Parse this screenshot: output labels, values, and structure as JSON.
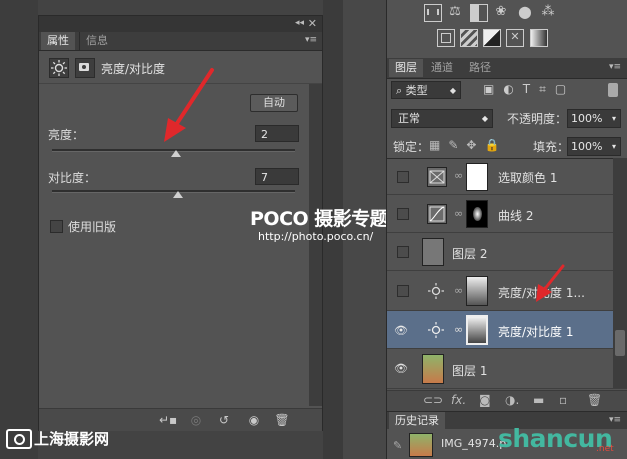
{
  "properties_panel": {
    "tabs": [
      {
        "label": "属性"
      },
      {
        "label": "信息"
      }
    ],
    "header_title": "亮度/对比度",
    "auto_button": "自动",
    "brightness": {
      "label": "亮度：",
      "value": "2",
      "level": 0.51
    },
    "contrast": {
      "label": "对比度：",
      "value": "7",
      "level": 0.52
    },
    "legacy_checkbox": {
      "label": "使用旧版",
      "checked": false
    }
  },
  "layers_panel": {
    "tabs": [
      {
        "label": "图层"
      },
      {
        "label": "通道"
      },
      {
        "label": "路径"
      }
    ],
    "filter_kind": "类型",
    "blend_mode": "正常",
    "opacity_label": "不透明度：",
    "opacity_value": "100%",
    "lock_label": "锁定：",
    "fill_label": "填充：",
    "fill_value": "100%",
    "layers": [
      {
        "name": "选取颜色 1",
        "type": "adjustment",
        "icon": "selective-color-icon",
        "visible": false,
        "selected": false
      },
      {
        "name": "曲线 2",
        "type": "adjustment",
        "icon": "curves-icon",
        "visible": false,
        "selected": false
      },
      {
        "name": "图层 2",
        "type": "pixel",
        "icon": "",
        "visible": false,
        "selected": false
      },
      {
        "name": "亮度/对比度 1...",
        "type": "adjustment",
        "icon": "brightness-icon",
        "visible": false,
        "selected": false
      },
      {
        "name": "亮度/对比度 1",
        "type": "adjustment",
        "icon": "brightness-icon",
        "visible": true,
        "selected": true
      },
      {
        "name": "图层 1",
        "type": "pixel",
        "icon": "",
        "visible": true,
        "selected": false
      }
    ]
  },
  "history_panel": {
    "title": "历史记录",
    "item": "IMG_4974.p"
  },
  "watermarks": {
    "poco_brand": "POCO 摄影专题",
    "poco_url": "http://photo.poco.cn/",
    "shanghai": "上海摄影网",
    "shancun": "shancun",
    "shancun_suffix": ".net"
  },
  "colors": {
    "panel": "#535353",
    "selected_layer": "#5b6f8a",
    "arrow": "#e0282b"
  }
}
